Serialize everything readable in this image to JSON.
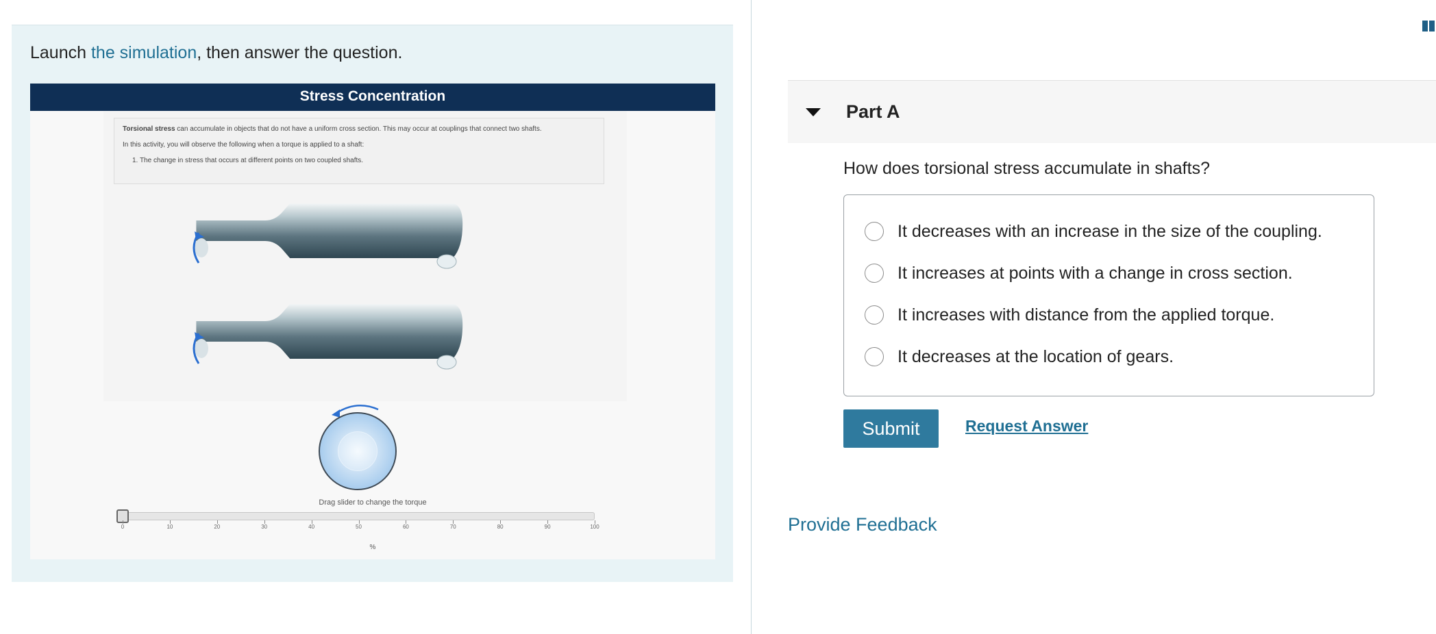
{
  "intro": {
    "before": "Launch ",
    "link": "the simulation",
    "after": ", then answer the question."
  },
  "simulation": {
    "title": "Stress Concentration",
    "info_lead_bold": "Torsional stress",
    "info_lead_rest": " can accumulate in objects that do not have a uniform cross section. This may occur at couplings that connect two shafts.",
    "info_line2": "In this activity, you will observe the following when a torque is applied to a shaft:",
    "info_item": "1.  The change in stress that occurs at different points on two coupled shafts.",
    "slider_caption": "Drag slider to change the torque",
    "slider_value": 0,
    "slider_ticks": [
      "0",
      "10",
      "20",
      "30",
      "40",
      "50",
      "60",
      "70",
      "80",
      "90",
      "100"
    ],
    "slider_unit": "%"
  },
  "part": {
    "title": "Part A",
    "question": "How does torsional stress accumulate in shafts?",
    "options": [
      "It decreases with an increase in the size of the coupling.",
      "It increases at points with a change in cross section.",
      "It increases with distance from the applied torque.",
      "It decreases at the location of gears."
    ],
    "submit_label": "Submit",
    "request_label": "Request Answer"
  },
  "feedback_label": "Provide Feedback",
  "colors": {
    "accent": "#2f7a9e",
    "link": "#1f6f93",
    "sim_header": "#0f2f55",
    "pane_bg": "#e8f3f6"
  }
}
